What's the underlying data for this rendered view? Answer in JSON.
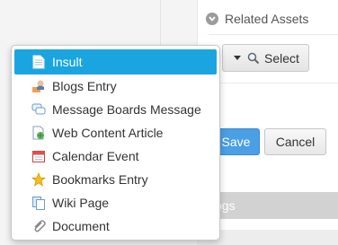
{
  "related_assets": {
    "title": "Related Assets",
    "select_label": "Select"
  },
  "actions": {
    "save_label": "Save",
    "cancel_label": "Cancel"
  },
  "blogs_bar": {
    "label": "ogs"
  },
  "menu": {
    "items": [
      {
        "label": "Insult",
        "icon": "document-icon"
      },
      {
        "label": "Blogs Entry",
        "icon": "blogs-icon"
      },
      {
        "label": "Message Boards Message",
        "icon": "message-icon"
      },
      {
        "label": "Web Content Article",
        "icon": "web-content-icon"
      },
      {
        "label": "Calendar Event",
        "icon": "calendar-icon"
      },
      {
        "label": "Bookmarks Entry",
        "icon": "star-icon"
      },
      {
        "label": "Wiki Page",
        "icon": "wiki-icon"
      },
      {
        "label": "Document",
        "icon": "paperclip-icon"
      }
    ]
  },
  "colors": {
    "accent": "#1aa5e0",
    "primary_button": "#4a9fe5",
    "bar_gray": "#d2d2d2"
  }
}
